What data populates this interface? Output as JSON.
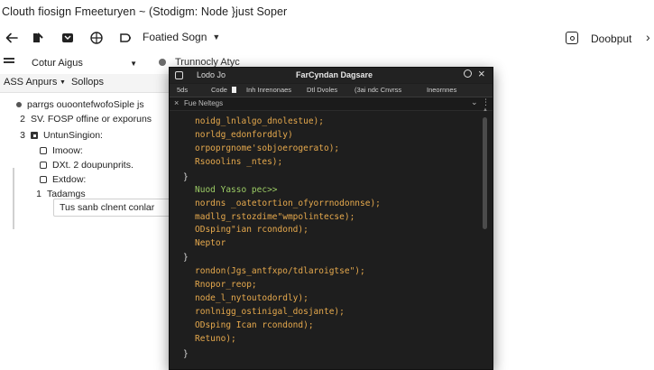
{
  "window": {
    "title": "Clouth fiosign Fmeeturyen ~ (Stodigm: Node }just Soper"
  },
  "toolbar": {
    "dropdown_label": "Foatied Sogn",
    "right_label": "Doobput",
    "right_more": "›"
  },
  "row2": {
    "select_value": "Cotur Aigus",
    "record_label": "Trunnocly Atyc"
  },
  "left_panel": {
    "tab1_label": "ASS Anpurs",
    "tab2_label": "Sollops",
    "items": [
      {
        "num": "",
        "label": "parrgs ouoontefwofoSiple js"
      },
      {
        "num": "2",
        "label": "SV. FOSP offine or exporuns"
      },
      {
        "num": "3",
        "label": "UntunSingion:"
      },
      {
        "num": "",
        "label": "Imoow:"
      },
      {
        "num": "",
        "label": "DXt. 2 doupunprits."
      },
      {
        "num": "",
        "label": "Extdow:"
      },
      {
        "num": "1",
        "label": "Tadamgs"
      }
    ],
    "input_value": "Tus sanb clnent conlar"
  },
  "dialog": {
    "short_label": "Lodo Jo",
    "title": "FarCyndan Dagsare",
    "tabs": [
      "5ds",
      "Code",
      "Inh Inrenonaes",
      "Dtl Dvoles",
      "(3ai ndc Cnvrss",
      "Ineornnes"
    ],
    "sub_label": "Fue Neltegs",
    "code_lines": [
      {
        "text": "noidg_lnlalgo_dnolestue);",
        "color": "#e6a94d"
      },
      {
        "text": "norldg_edonforddly)",
        "color": "#e6a94d"
      },
      {
        "text": "orpoprgnome'sobjoerogerato);",
        "color": "#e6a94d"
      },
      {
        "text": "Rsooolins _ntes);",
        "color": "#e6a94d"
      },
      {
        "text": "}",
        "color": "#d7d7d7"
      },
      {
        "text": "Nuod Yasso pec>>",
        "color": "#9ccc65"
      },
      {
        "text": "nordns _oatetortion_ofyorrnodonnse);",
        "color": "#e6a94d"
      },
      {
        "text": "madllg_rstozdime\"wmpolintecse);",
        "color": "#e6a94d"
      },
      {
        "text": "ODsping\"ian rcondond);",
        "color": "#e6a94d"
      },
      {
        "text": "Neptor",
        "color": "#e6a94d"
      },
      {
        "text": "}",
        "color": "#d7d7d7"
      },
      {
        "text": "rondon(Jgs_antfxpo/tdlaroigtse\");",
        "color": "#e6a94d"
      },
      {
        "text": "Rnopor_reop;",
        "color": "#e6a94d"
      },
      {
        "text": "node_l_nytoutodordly);",
        "color": "#e6a94d"
      },
      {
        "text": "ronlnigg_ostinigal_dosjante);",
        "color": "#e6a94d"
      },
      {
        "text": "ODsping Ican rcondond);",
        "color": "#e6a94d"
      },
      {
        "text": "Retuno);",
        "color": "#e6a94d"
      },
      {
        "text": "}",
        "color": "#d7d7d7"
      }
    ]
  }
}
